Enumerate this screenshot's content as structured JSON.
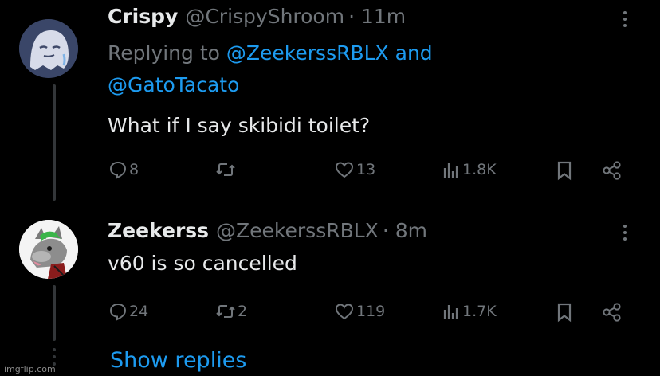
{
  "tweets": [
    {
      "display_name": "Crispy",
      "handle": "@CrispyShroom",
      "time": "· 11m",
      "replying_prefix": "Replying to",
      "replying_user_1": "@ZeekerssRBLX",
      "replying_and": "and",
      "replying_user_2": "@GatoTacato",
      "text": "What if I say skibidi toilet?",
      "replies": "8",
      "retweets": "",
      "likes": "13",
      "views": "1.8K",
      "avatar_icon": "ghost-avatar"
    },
    {
      "display_name": "Zeekerss",
      "handle": "@ZeekerssRBLX",
      "time": "· 8m",
      "text": "v60 is so cancelled",
      "replies": "24",
      "retweets": "2",
      "likes": "119",
      "views": "1.7K",
      "avatar_icon": "wolf-avatar"
    }
  ],
  "show_replies_label": "Show replies",
  "watermark": "imgflip.com",
  "colors": {
    "background": "#000000",
    "text": "#e7e9ea",
    "muted": "#71767b",
    "link": "#1d9bf0",
    "thread_line": "#333639"
  }
}
